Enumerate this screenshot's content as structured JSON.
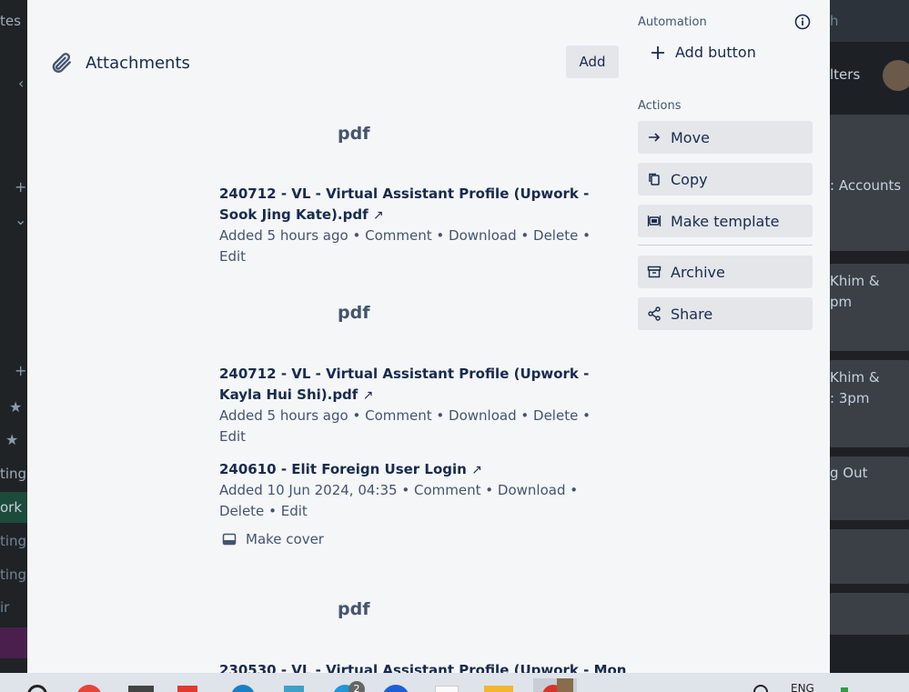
{
  "background": {
    "left_fragments": [
      "tes",
      "ting",
      "ork",
      "ting",
      "ting",
      "ir"
    ],
    "right_fragments": [
      "h",
      "lters",
      ": Accounts",
      "Khim &",
      "pm",
      "Khim &",
      ": 3pm",
      "g Out"
    ]
  },
  "attachments": {
    "title": "Attachments",
    "add_label": "Add",
    "items": [
      {
        "thumb": "pdf",
        "name": "240712 - VL - Virtual Assistant Profile (Upwork - Sook Jing Kate).pdf",
        "added": "Added 5 hours ago",
        "actions": [
          "Comment",
          "Download",
          "Delete",
          "Edit"
        ]
      },
      {
        "thumb": "pdf",
        "name": "240712 - VL - Virtual Assistant Profile (Upwork - Kayla Hui Shi).pdf",
        "added": "Added 5 hours ago",
        "actions": [
          "Comment",
          "Download",
          "Delete",
          "Edit"
        ]
      },
      {
        "thumb": "",
        "name": "240610 - Elit Foreign User Login",
        "added": "Added 10 Jun 2024, 04:35",
        "actions": [
          "Comment",
          "Download",
          "Delete",
          "Edit"
        ],
        "cover_label": "Make cover"
      },
      {
        "thumb": "pdf",
        "name": "230530 - VL - Virtual Assistant Profile (Upwork - Mon"
      }
    ],
    "external_link_glyph": "↗",
    "separator": "•"
  },
  "sidebar": {
    "automation_label": "Automation",
    "add_button_label": "Add button",
    "actions_label": "Actions",
    "actions": [
      {
        "label": "Move",
        "icon": "arrow-right-icon"
      },
      {
        "label": "Copy",
        "icon": "copy-icon"
      },
      {
        "label": "Make template",
        "icon": "template-icon"
      },
      {
        "label": "Archive",
        "icon": "archive-icon"
      },
      {
        "label": "Share",
        "icon": "share-icon"
      }
    ]
  },
  "taskbar": {
    "language": "ENG",
    "badge_count": "2"
  }
}
